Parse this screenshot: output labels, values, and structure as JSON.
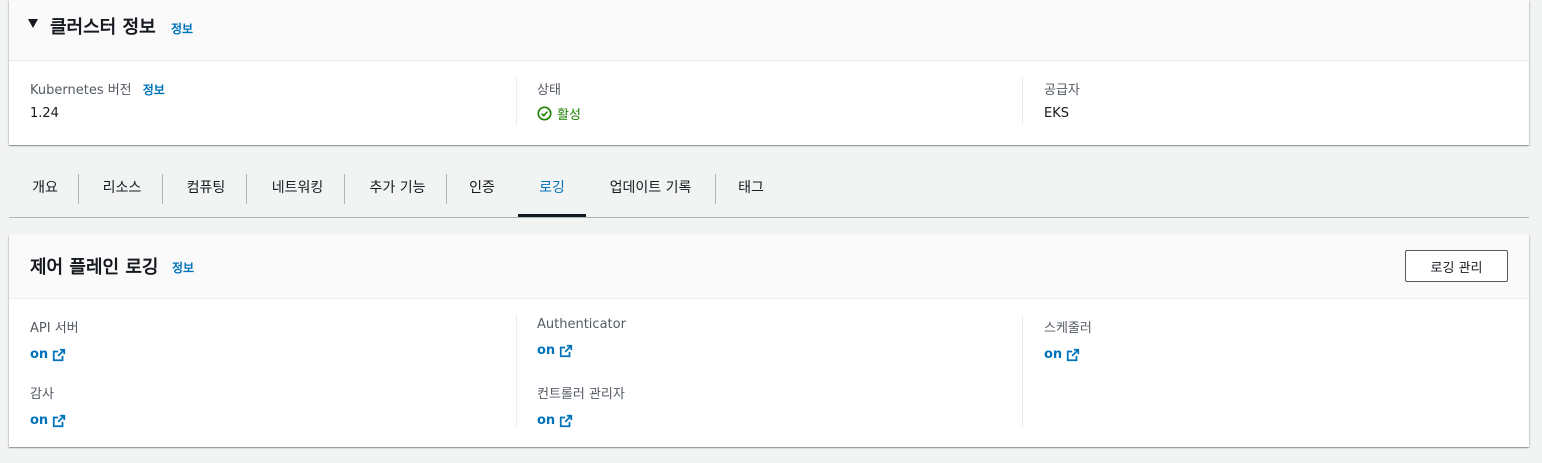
{
  "cluster_info": {
    "title": "클러스터 정보",
    "info_link": "정보",
    "k8s_label": "Kubernetes 버전",
    "k8s_info": "정보",
    "k8s_value": "1.24",
    "status_label": "상태",
    "status_value": "활성",
    "provider_label": "공급자",
    "provider_value": "EKS",
    "status_color": "#1d8102"
  },
  "tabs": [
    {
      "label": "개요"
    },
    {
      "label": "리소스"
    },
    {
      "label": "컴퓨팅"
    },
    {
      "label": "네트워킹"
    },
    {
      "label": "추가 기능"
    },
    {
      "label": "인증"
    },
    {
      "label": "로깅"
    },
    {
      "label": "업데이트 기록"
    },
    {
      "label": "태그"
    }
  ],
  "active_tab": "로깅",
  "logging": {
    "title": "제어 플레인 로깅",
    "info_link": "정보",
    "manage_button": "로깅 관리",
    "items": {
      "api_server": {
        "label": "API 서버",
        "value": "on"
      },
      "authenticator": {
        "label": "Authenticator",
        "value": "on"
      },
      "scheduler": {
        "label": "스케줄러",
        "value": "on"
      },
      "audit": {
        "label": "감사",
        "value": "on"
      },
      "controller_manager": {
        "label": "컨트롤러 관리자",
        "value": "on"
      }
    }
  },
  "colors": {
    "link": "#0073bb",
    "page_bg": "#f2f3f3"
  }
}
